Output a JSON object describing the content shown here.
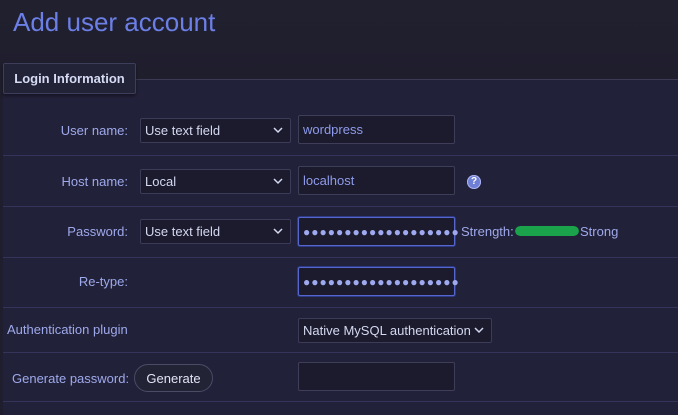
{
  "page": {
    "title": "Add user account"
  },
  "fieldset": {
    "legend": "Login Information"
  },
  "username": {
    "label": "User name:",
    "select_value": "Use text field",
    "value": "wordpress"
  },
  "hostname": {
    "label": "Host name:",
    "select_value": "Local",
    "value": "localhost",
    "help_icon": "help-icon"
  },
  "password": {
    "label": "Password:",
    "select_value": "Use text field",
    "value": "●●●●●●●●●●●●●●●●●●●",
    "strength_label": "Strength:",
    "strength_text": "Strong",
    "strength_level": 1.0,
    "strength_color": "#1aa34a"
  },
  "retype": {
    "label": "Re-type:",
    "value": "●●●●●●●●●●●●●●●●●●●"
  },
  "auth_plugin": {
    "label": "Authentication plugin",
    "select_value": "Native MySQL authentication"
  },
  "generate": {
    "label": "Generate password:",
    "button_label": "Generate",
    "value": ""
  },
  "colors": {
    "accent": "#6b7fe6",
    "background": "#1e1e2e"
  }
}
